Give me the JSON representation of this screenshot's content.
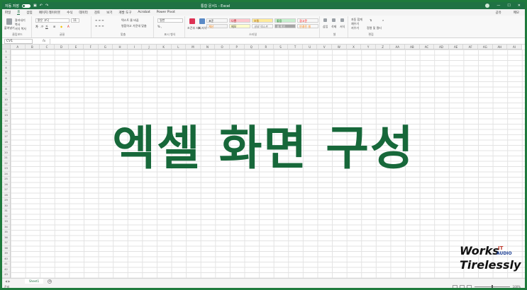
{
  "titlebar": {
    "autosave_label": "자동 저장",
    "doc_title": "통합 문서1 - Excel"
  },
  "menu": {
    "tabs": [
      "파일",
      "홈",
      "삽입",
      "페이지 레이아웃",
      "수식",
      "데이터",
      "검토",
      "보기",
      "개발 도구",
      "Acrobat",
      "Power Pivot"
    ],
    "active_tab": "홈",
    "share_label": "공유",
    "comment_label": "메모"
  },
  "ribbon": {
    "clipboard": {
      "paste": "붙여넣기",
      "cut": "잘라내기",
      "copy": "복사",
      "painter": "서식 복사",
      "label": "클립보드"
    },
    "font": {
      "name": "맑은 고딕",
      "size": "11",
      "label": "글꼴"
    },
    "alignment": {
      "wrap": "텍스트 줄 바꿈",
      "merge": "병합하고 가운데 맞춤",
      "label": "맞춤"
    },
    "number": {
      "format": "일반",
      "label": "표시 형식"
    },
    "styles": {
      "conditional": "조건부 서식",
      "table": "표 서식",
      "cells": [
        {
          "text": "표준",
          "bg": "#ffffff",
          "color": "#333333"
        },
        {
          "text": "나쁨",
          "bg": "#ffc7ce",
          "color": "#9c0006"
        },
        {
          "text": "보통",
          "bg": "#ffeb9c",
          "color": "#9c5700"
        },
        {
          "text": "좋음",
          "bg": "#c6efce",
          "color": "#006100"
        },
        {
          "text": "경고문",
          "bg": "#ffffff",
          "color": "#ff0000"
        },
        {
          "text": "계산",
          "bg": "#f2f2f2",
          "color": "#fa7d00"
        },
        {
          "text": "메모",
          "bg": "#ffffcc",
          "color": "#333333"
        },
        {
          "text": "설명 텍스트",
          "bg": "#ffffff",
          "color": "#7f7f7f"
        },
        {
          "text": "셀 확인",
          "bg": "#a5a5a5",
          "color": "#ffffff"
        },
        {
          "text": "연결된 셀",
          "bg": "#ffffff",
          "color": "#fa7d00"
        }
      ],
      "label": "스타일"
    },
    "cells_group": {
      "insert": "삽입",
      "delete": "삭제",
      "format": "서식",
      "label": "셀"
    },
    "editing": {
      "autosum": "자동 합계",
      "fill": "채우기",
      "clear": "지우기",
      "sort": "정렬 및 필터",
      "find": "찾기 및 선택",
      "label": "편집"
    }
  },
  "formula_bar": {
    "name_box": "CV1",
    "fx": "fx",
    "formula": ""
  },
  "grid": {
    "columns": [
      "A",
      "B",
      "C",
      "D",
      "E",
      "F",
      "G",
      "H",
      "I",
      "J",
      "K",
      "L",
      "M",
      "N",
      "O",
      "P",
      "Q",
      "R",
      "S",
      "T",
      "U",
      "V",
      "W",
      "X",
      "Y",
      "Z",
      "AA",
      "AB",
      "AC",
      "AD",
      "AE",
      "AF",
      "AG",
      "AH",
      "AI"
    ],
    "rows": [
      "1",
      "2",
      "3",
      "4",
      "5",
      "6",
      "7",
      "8",
      "9",
      "10",
      "11",
      "12",
      "13",
      "14",
      "15",
      "16",
      "17",
      "18",
      "19",
      "20",
      "21",
      "22",
      "23",
      "24",
      "25",
      "26",
      "27",
      "28",
      "29",
      "30",
      "31",
      "32",
      "33",
      "34",
      "35",
      "36",
      "37",
      "38",
      "39",
      "40",
      "41",
      "42",
      "43"
    ]
  },
  "overlay": {
    "title": "엑셀 화면 구성"
  },
  "watermark": {
    "line1": "Works",
    "line2": "Tirelessly",
    "badge_it": "IT",
    "badge_audio": "AUDIO"
  },
  "sheets": {
    "tabs": [
      "Sheet1"
    ],
    "add_symbol": "+",
    "nav": "◀ ▶"
  },
  "status": {
    "ready": "준비",
    "zoom": "100%"
  }
}
